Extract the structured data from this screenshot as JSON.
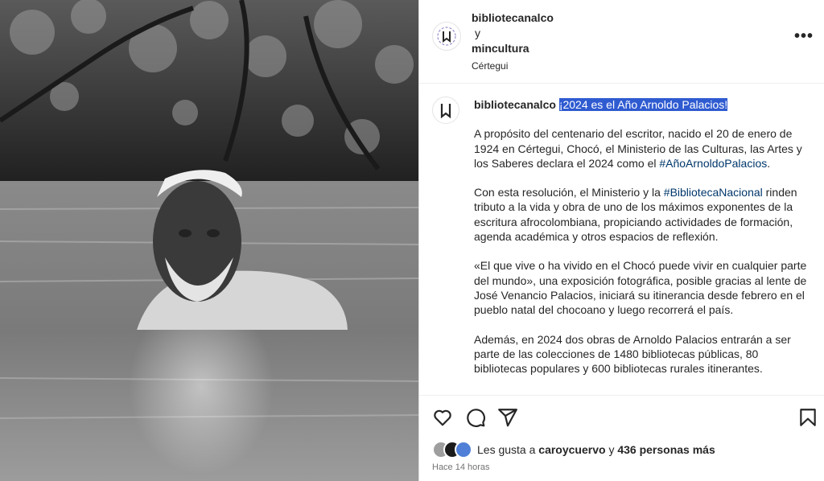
{
  "header": {
    "account1": "bibliotecanalco",
    "joiner": "y",
    "account2": "mincultura",
    "location": "Cértegui",
    "more_label": "•••"
  },
  "caption": {
    "username": "bibliotecanalco",
    "headline": "¡2024 es el Año Arnoldo Palacios!",
    "p1_before": "A propósito del centenario del escritor, nacido el 20 de enero de 1924 en Cértegui, Chocó, el Ministerio de las Culturas, las Artes y los Saberes declara el 2024 como el ",
    "p1_tag": "#AñoArnoldoPalacios",
    "p1_after": ".",
    "p2_before": "Con esta resolución, el Ministerio y la ",
    "p2_tag": "#BibliotecaNacional",
    "p2_after": " rinden tributo a la vida y obra de uno de los máximos exponentes de la escritura afrocolombiana, propiciando actividades de formación, agenda académica y otros espacios de reflexión.",
    "p3": "«El que vive o ha vivido en el Chocó puede vivir en cualquier parte del mundo», una exposición fotográfica, posible gracias al lente de José Venancio Palacios, iniciará su itinerancia desde febrero en el pueblo natal del chocoano y luego recorrerá el país.",
    "p4": "Además, en 2024 dos obras de Arnoldo Palacios entrarán a ser parte de las colecciones de 1480 bibliotecas públicas, 80 bibliotecas populares y 600 bibliotecas rurales itinerantes."
  },
  "footer": {
    "likes_prefix": "Les gusta a ",
    "likes_user": "caroycuervo",
    "likes_mid": " y ",
    "likes_count": "436 personas más",
    "time": "Hace 14 horas"
  },
  "icons": [
    "heart-icon",
    "comment-icon",
    "share-icon",
    "bookmark-icon",
    "more-icon",
    "library-logo-icon"
  ],
  "colors": {
    "selection": "#2f5bd1",
    "hashtag": "#00376b",
    "text": "#262626",
    "muted": "#737373"
  }
}
